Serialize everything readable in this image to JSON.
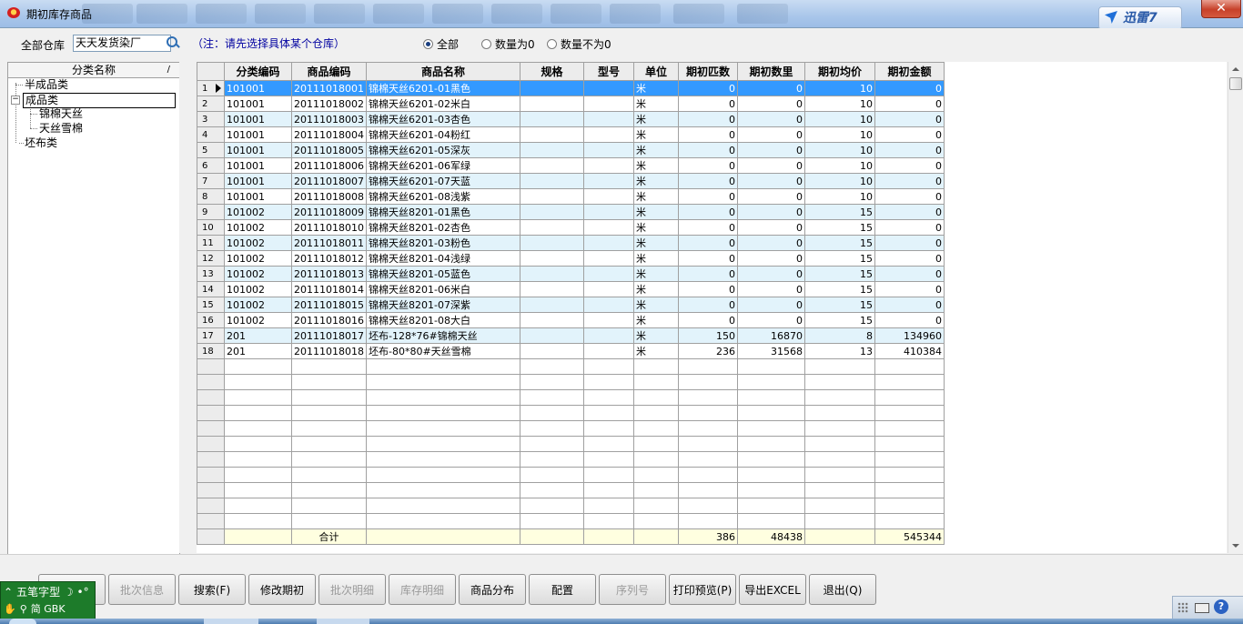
{
  "window": {
    "title": "期初库存商品",
    "close_glyph": "✕"
  },
  "xunlei": {
    "label": "迅雷7"
  },
  "toolbar": {
    "warehouse_label": "全部仓库",
    "warehouse_value": "天天发货染厂",
    "note": "（注：请先选择具体某个仓库）",
    "radios": [
      {
        "label": "全部",
        "checked": true
      },
      {
        "label": "数量为0",
        "checked": false
      },
      {
        "label": "数量不为0",
        "checked": false
      }
    ]
  },
  "tree": {
    "header": "分类名称",
    "sort_glyph": "/",
    "nodes": {
      "semi": "半成品类",
      "finished": "成品类",
      "child1": "锦棉天丝",
      "child2": "天丝雪棉",
      "raw": "坯布类"
    },
    "expander": "−"
  },
  "grid": {
    "columns": [
      "分类编码",
      "商品编码",
      "商品名称",
      "规格",
      "型号",
      "单位",
      "期初匹数",
      "期初数里",
      "期初均价",
      "期初金额"
    ],
    "rows": [
      [
        "1",
        "101001",
        "20111018001",
        "锦棉天丝6201-01黑色",
        "",
        "",
        "米",
        "0",
        "0",
        "10",
        "0"
      ],
      [
        "2",
        "101001",
        "20111018002",
        "锦棉天丝6201-02米白",
        "",
        "",
        "米",
        "0",
        "0",
        "10",
        "0"
      ],
      [
        "3",
        "101001",
        "20111018003",
        "锦棉天丝6201-03杏色",
        "",
        "",
        "米",
        "0",
        "0",
        "10",
        "0"
      ],
      [
        "4",
        "101001",
        "20111018004",
        "锦棉天丝6201-04粉红",
        "",
        "",
        "米",
        "0",
        "0",
        "10",
        "0"
      ],
      [
        "5",
        "101001",
        "20111018005",
        "锦棉天丝6201-05深灰",
        "",
        "",
        "米",
        "0",
        "0",
        "10",
        "0"
      ],
      [
        "6",
        "101001",
        "20111018006",
        "锦棉天丝6201-06军绿",
        "",
        "",
        "米",
        "0",
        "0",
        "10",
        "0"
      ],
      [
        "7",
        "101001",
        "20111018007",
        "锦棉天丝6201-07天蓝",
        "",
        "",
        "米",
        "0",
        "0",
        "10",
        "0"
      ],
      [
        "8",
        "101001",
        "20111018008",
        "锦棉天丝6201-08浅紫",
        "",
        "",
        "米",
        "0",
        "0",
        "10",
        "0"
      ],
      [
        "9",
        "101002",
        "20111018009",
        "锦棉天丝8201-01黑色",
        "",
        "",
        "米",
        "0",
        "0",
        "15",
        "0"
      ],
      [
        "10",
        "101002",
        "20111018010",
        "锦棉天丝8201-02杏色",
        "",
        "",
        "米",
        "0",
        "0",
        "15",
        "0"
      ],
      [
        "11",
        "101002",
        "20111018011",
        "锦棉天丝8201-03粉色",
        "",
        "",
        "米",
        "0",
        "0",
        "15",
        "0"
      ],
      [
        "12",
        "101002",
        "20111018012",
        "锦棉天丝8201-04浅绿",
        "",
        "",
        "米",
        "0",
        "0",
        "15",
        "0"
      ],
      [
        "13",
        "101002",
        "20111018013",
        "锦棉天丝8201-05蓝色",
        "",
        "",
        "米",
        "0",
        "0",
        "15",
        "0"
      ],
      [
        "14",
        "101002",
        "20111018014",
        "锦棉天丝8201-06米白",
        "",
        "",
        "米",
        "0",
        "0",
        "15",
        "0"
      ],
      [
        "15",
        "101002",
        "20111018015",
        "锦棉天丝8201-07深紫",
        "",
        "",
        "米",
        "0",
        "0",
        "15",
        "0"
      ],
      [
        "16",
        "101002",
        "20111018016",
        "锦棉天丝8201-08大白",
        "",
        "",
        "米",
        "0",
        "0",
        "15",
        "0"
      ],
      [
        "17",
        "201",
        "20111018017",
        "坯布-128*76#锦棉天丝",
        "",
        "",
        "米",
        "150",
        "16870",
        "8",
        "134960"
      ],
      [
        "18",
        "201",
        "20111018018",
        "坯布-80*80#天丝雪棉",
        "",
        "",
        "米",
        "236",
        "31568",
        "13",
        "410384"
      ]
    ],
    "total": {
      "label": "合计",
      "pieces": "386",
      "quantity": "48438",
      "amount": "545344"
    }
  },
  "buttons": [
    {
      "label": "",
      "disabled": true
    },
    {
      "label": "批次信息",
      "disabled": true
    },
    {
      "label": "搜索(F)",
      "disabled": false
    },
    {
      "label": "修改期初",
      "disabled": false
    },
    {
      "label": "批次明细",
      "disabled": true
    },
    {
      "label": "库存明细",
      "disabled": true
    },
    {
      "label": "商品分布",
      "disabled": false
    },
    {
      "label": "配置",
      "disabled": false
    },
    {
      "label": "序列号",
      "disabled": true
    },
    {
      "label": "打印预览(P)",
      "disabled": false
    },
    {
      "label": "导出EXCEL",
      "disabled": false
    },
    {
      "label": "退出(Q)",
      "disabled": false
    }
  ],
  "ime": {
    "mode": "五笔字型",
    "moon": "☽",
    "punct": "•°",
    "simplified": "简",
    "charset": "GBK"
  },
  "tray": {
    "help": "?"
  },
  "colors": {
    "selected_row": "#3399ff",
    "alt_row": "#e2f3fb",
    "total_row": "#ffffe0"
  }
}
